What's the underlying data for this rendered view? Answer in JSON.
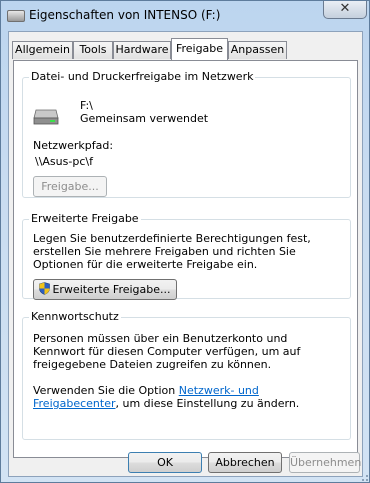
{
  "window": {
    "title": "Eigenschaften von INTENSO (F:)",
    "close_glyph": "✕"
  },
  "tabs": [
    {
      "label": "Allgemein"
    },
    {
      "label": "Tools"
    },
    {
      "label": "Hardware"
    },
    {
      "label": "Freigabe",
      "active": true
    },
    {
      "label": "Anpassen"
    }
  ],
  "network_sharing": {
    "group_title": "Datei- und Druckerfreigabe im Netzwerk",
    "drive_name": "F:\\",
    "drive_status": "Gemeinsam verwendet",
    "path_label": "Netzwerkpfad:",
    "path_value": "\\\\Asus-pc\\f",
    "share_button": "Freigabe..."
  },
  "advanced_sharing": {
    "group_title": "Erweiterte Freigabe",
    "description": "Legen Sie benutzerdefinierte Berechtigungen fest, erstellen Sie mehrere Freigaben und richten Sie Optionen für die erweiterte Freigabe ein.",
    "button": "Erweiterte Freigabe..."
  },
  "password_protection": {
    "group_title": "Kennwortschutz",
    "description": "Personen müssen über ein Benutzerkonto und Kennwort für diesen Computer verfügen, um auf freigegebene Dateien zugreifen zu können.",
    "settings_prefix": "Verwenden Sie die Option ",
    "settings_link": "Netzwerk- und Freigabecenter",
    "settings_suffix": ", um diese Einstellung zu ändern."
  },
  "dialog_buttons": {
    "ok": "OK",
    "cancel": "Abbrechen",
    "apply": "Übernehmen"
  },
  "icons": {
    "drive": "drive-icon",
    "shield": "uac-shield-icon",
    "close": "close-icon"
  }
}
